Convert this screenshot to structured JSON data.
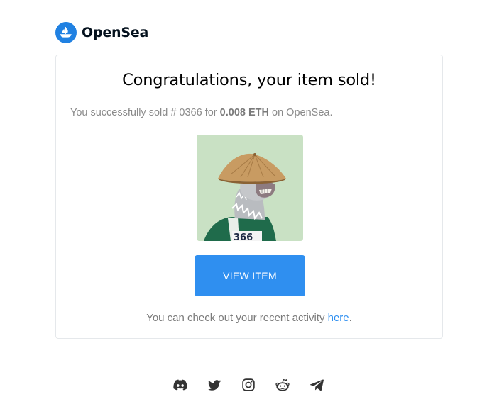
{
  "brand": {
    "name": "OpenSea",
    "logo_icon": "opensea-ship-icon",
    "logo_color": "#2081e2"
  },
  "message": {
    "headline": "Congratulations, your item sold!",
    "sold_prefix": "You successfully sold # 0366 for",
    "price": "0.008 ETH",
    "sold_suffix": "on OpenSea."
  },
  "item": {
    "image_icon": "nft-llama-with-straw-hat",
    "jersey_number": "366",
    "background_color": "#c9e1c4"
  },
  "cta": {
    "label": "VIEW ITEM",
    "color": "#2f8ff0"
  },
  "activity": {
    "text": "You can check out your recent activity",
    "link_label": "here",
    "trailing": "."
  },
  "footer": {
    "social_icons": [
      "discord-icon",
      "twitter-icon",
      "instagram-icon",
      "reddit-icon",
      "telegram-icon"
    ]
  }
}
